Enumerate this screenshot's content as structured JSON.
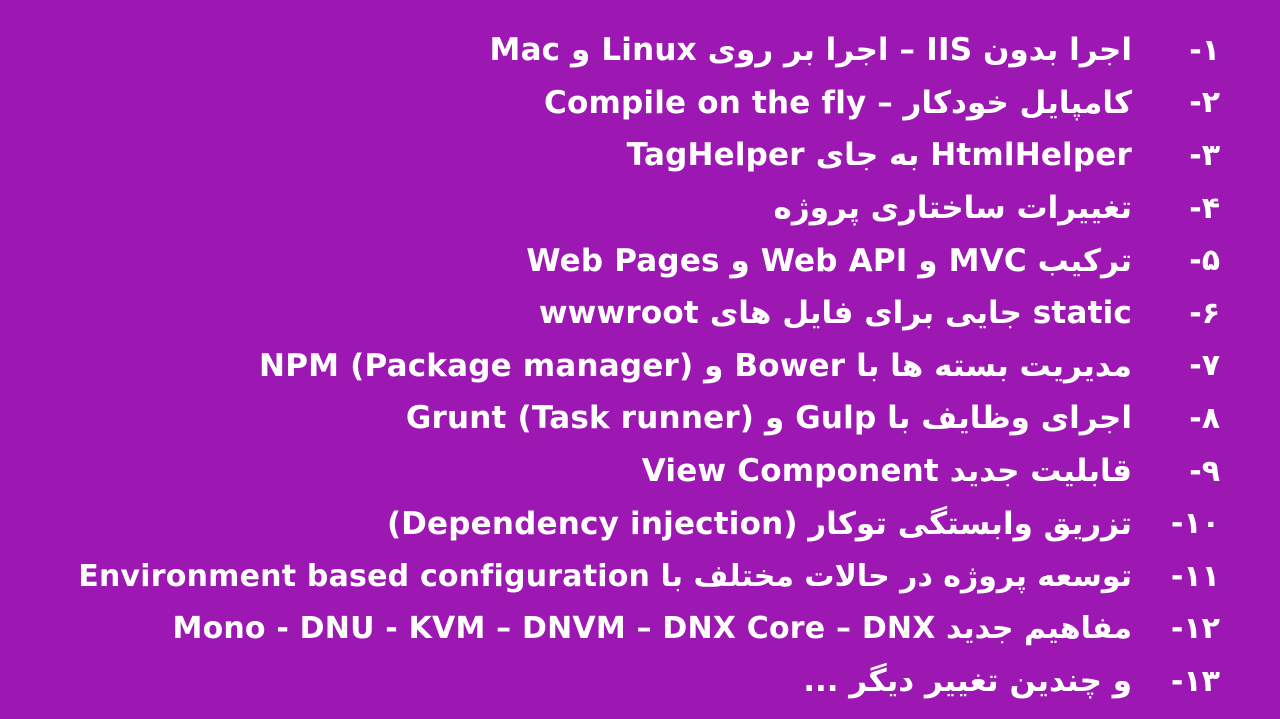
{
  "slide": {
    "background": "#9d18b2",
    "text_color": "#ffffff",
    "items": [
      {
        "number": "۱-",
        "text": "اجرا بدون IIS – اجرا بر روی Linux و Mac"
      },
      {
        "number": "۲-",
        "text": "کامپایل خودکار – Compile on the fly"
      },
      {
        "number": "۳-",
        "text": "TagHelper به جای HtmlHelper"
      },
      {
        "number": "۴-",
        "text": "تغییرات ساختاری پروژه"
      },
      {
        "number": "۵-",
        "text": "ترکیب MVC و Web API و Web Pages"
      },
      {
        "number": "۶-",
        "text": "wwwroot جایی برای فایل های static"
      },
      {
        "number": "۷-",
        "text": "مدیریت بسته ها با Bower و  NPM (Package manager)"
      },
      {
        "number": "۸-",
        "text": "اجرای وظایف با Gulp و  Grunt (Task runner)"
      },
      {
        "number": "۹-",
        "text": "قابلیت جدید View Component"
      },
      {
        "number": "۱۰-",
        "text": "تزریق وابستگی توکار (Dependency injection)"
      },
      {
        "number": "۱۱-",
        "text": "توسعه پروژه در حالات مختلف با Environment based configuration"
      },
      {
        "number": "۱۲-",
        "text": "مفاهیم جدید Mono - DNU - KVM – DNVM – DNX Core – DNX"
      },
      {
        "number": "۱۳-",
        "text": "و چندین تغییر دیگر ..."
      }
    ]
  }
}
